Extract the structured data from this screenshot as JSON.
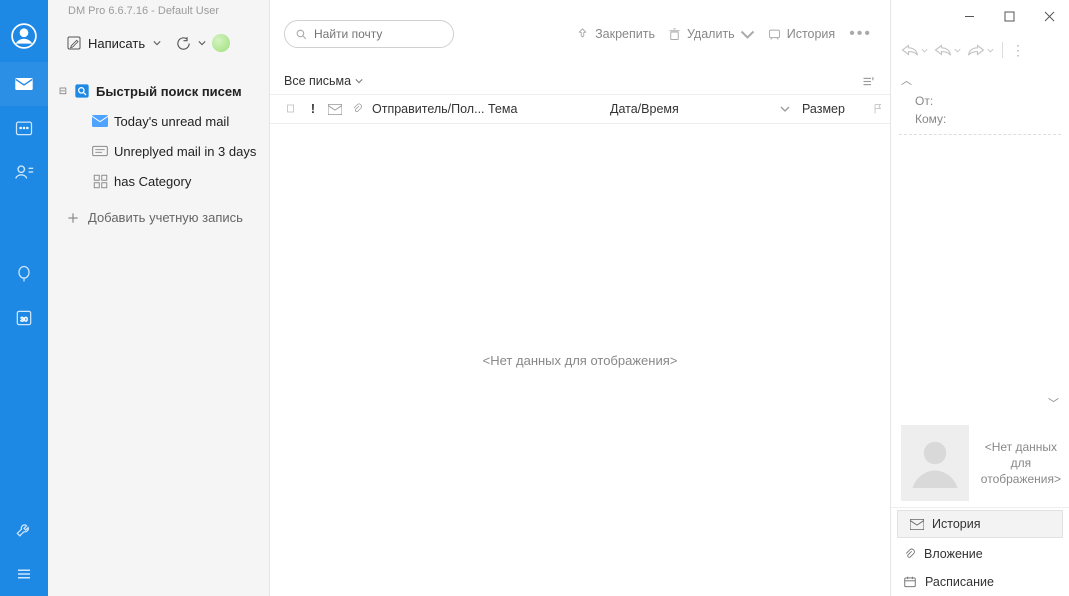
{
  "app_title": "DM Pro 6.6.7.16  -  Default User",
  "vbar": {
    "items": [
      "profile",
      "mail",
      "calendar",
      "contacts",
      "spacer-small",
      "chat",
      "notes",
      "spacer",
      "settings",
      "menu"
    ]
  },
  "compose": {
    "label": "Написать"
  },
  "tree": {
    "root": {
      "label": "Быстрый поиск писем"
    },
    "children": [
      {
        "icon": "mail-blue",
        "label": "Today's unread mail"
      },
      {
        "icon": "unreply",
        "label": "Unreplyed mail in 3 days"
      },
      {
        "icon": "category",
        "label": "has Category"
      }
    ]
  },
  "add_account": "Добавить учетную запись",
  "search": {
    "placeholder": "Найти почту"
  },
  "toolbar": {
    "pin": "Закрепить",
    "del": "Удалить",
    "history": "История"
  },
  "filter": {
    "label": "Все письма"
  },
  "columns": {
    "sender": "Отправитель/Пол...",
    "subject": "Тема",
    "date": "Дата/Время",
    "size": "Размер"
  },
  "empty": "<Нет данных для отображения>",
  "info": {
    "from": "От:",
    "to": "Кому:"
  },
  "contact_empty": "<Нет данных для отображения>",
  "tabs": {
    "history": "История",
    "attach": "Вложение",
    "schedule": "Расписание"
  }
}
